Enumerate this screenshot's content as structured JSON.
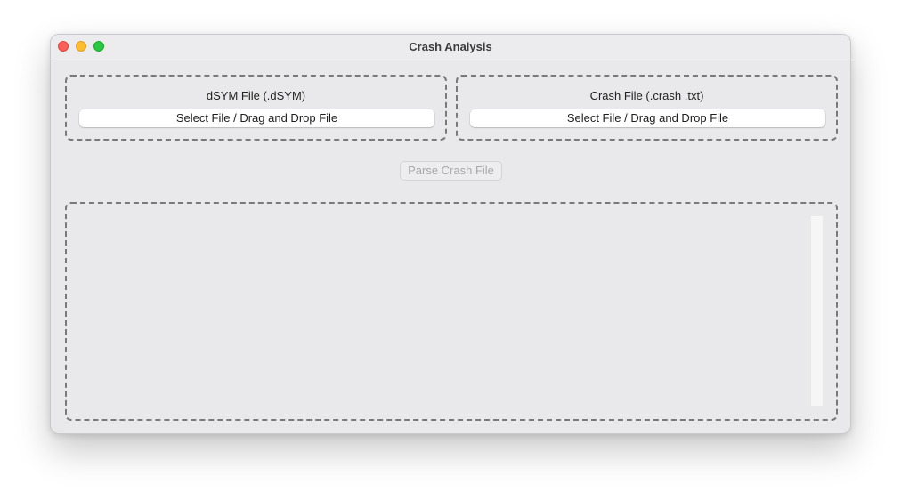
{
  "window": {
    "title": "Crash Analysis"
  },
  "dsym": {
    "label": "dSYM File (.dSYM)",
    "button_label": "Select File / Drag and Drop File"
  },
  "crash": {
    "label": "Crash File (.crash .txt)",
    "button_label": "Select File / Drag and Drop File"
  },
  "parse": {
    "button_label": "Parse Crash File",
    "enabled": false
  },
  "output": {
    "text": ""
  },
  "colors": {
    "close": "#fe5f57",
    "minimize": "#febc2e",
    "maximize": "#28c840",
    "window_bg": "#e9e9eb"
  }
}
